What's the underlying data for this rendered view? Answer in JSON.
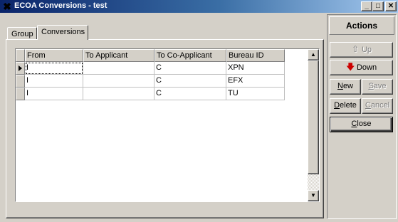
{
  "window": {
    "title": "ECOA Conversions - test",
    "app_icon": "x-app-icon",
    "controls": {
      "minimize": "_",
      "maximize": "□",
      "close": "✕"
    }
  },
  "tabs": [
    {
      "label": "Group",
      "active": false
    },
    {
      "label": "Conversions",
      "active": true
    }
  ],
  "grid": {
    "columns": [
      "From",
      "To Applicant",
      "To Co-Applicant",
      "Bureau ID"
    ],
    "rows": [
      {
        "current": true,
        "cells": [
          "I",
          "",
          "C",
          "XPN"
        ]
      },
      {
        "current": false,
        "cells": [
          "I",
          "",
          "C",
          "EFX"
        ]
      },
      {
        "current": false,
        "cells": [
          "I",
          "",
          "C",
          "TU"
        ]
      }
    ]
  },
  "actions": {
    "header": "Actions",
    "up": {
      "label": "Up",
      "enabled": false,
      "icon": "up-arrow-icon"
    },
    "down": {
      "label": "Down",
      "enabled": true,
      "icon": "down-arrow-icon",
      "icon_color": "#cc0000"
    },
    "new": {
      "label": "New",
      "mnemonic": "N",
      "rest": "ew",
      "enabled": true
    },
    "save": {
      "label": "Save",
      "mnemonic": "S",
      "rest": "ave",
      "enabled": false
    },
    "delete": {
      "label": "Delete",
      "mnemonic": "D",
      "rest": "elete",
      "enabled": true
    },
    "cancel": {
      "label": "Cancel",
      "mnemonic": "C",
      "rest": "ancel",
      "enabled": false
    },
    "close": {
      "label": "Close",
      "mnemonic": "C",
      "rest": "lose",
      "enabled": true
    }
  }
}
